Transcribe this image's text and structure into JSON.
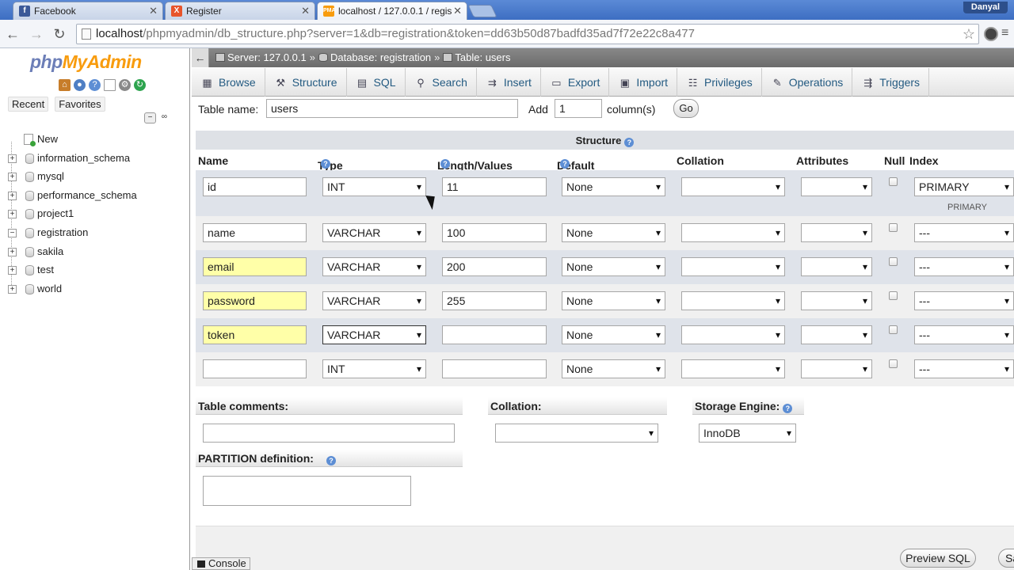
{
  "browser": {
    "tabs": [
      {
        "title": "Facebook",
        "icon": "facebook-icon",
        "color": "#3b5998"
      },
      {
        "title": "Register",
        "icon": "xampp-icon",
        "color": "#e8542b"
      },
      {
        "title": "localhost / 127.0.0.1 / regis",
        "icon": "phpmyadmin-icon",
        "color": "#f89c0e"
      }
    ],
    "user": "Danyal",
    "url_host": "localhost",
    "url_path": "/phpmyadmin/db_structure.php?server=1&db=registration&token=dd63b50d87badfd35ad7f72e22c8a477"
  },
  "sidebar": {
    "logo_php": "php",
    "logo_myadmin": "MyAdmin",
    "links": [
      "Recent",
      "Favorites"
    ],
    "tree": [
      {
        "label": "New",
        "type": "new"
      },
      {
        "label": "information_schema",
        "type": "db",
        "expander": "+"
      },
      {
        "label": "mysql",
        "type": "db",
        "expander": "+"
      },
      {
        "label": "performance_schema",
        "type": "db",
        "expander": "+"
      },
      {
        "label": "project1",
        "type": "db",
        "expander": "+"
      },
      {
        "label": "registration",
        "type": "db",
        "expander": "−"
      },
      {
        "label": "sakila",
        "type": "db",
        "expander": "+"
      },
      {
        "label": "test",
        "type": "db",
        "expander": "+"
      },
      {
        "label": "world",
        "type": "db",
        "expander": "+"
      }
    ]
  },
  "breadcrumb": {
    "server": "Server: 127.0.0.1",
    "database": "Database: registration",
    "table": "Table: users"
  },
  "menu": [
    "Browse",
    "Structure",
    "SQL",
    "Search",
    "Insert",
    "Export",
    "Import",
    "Privileges",
    "Operations",
    "Triggers"
  ],
  "table_form": {
    "table_name_label": "Table name:",
    "table_name_value": "users",
    "add_label": "Add",
    "add_value": "1",
    "columns_label": "column(s)",
    "go_label": "Go"
  },
  "structure": {
    "title": "Structure",
    "headers": [
      "Name",
      "Type",
      "Length/Values",
      "Default",
      "Collation",
      "Attributes",
      "Null",
      "Index"
    ],
    "rows": [
      {
        "name": "id",
        "type": "INT",
        "length": "11",
        "default": "None",
        "collation": "",
        "attributes": "",
        "index": "PRIMARY",
        "index_note": "PRIMARY",
        "highlight": false
      },
      {
        "name": "name",
        "type": "VARCHAR",
        "length": "100",
        "default": "None",
        "collation": "",
        "attributes": "",
        "index": "---",
        "index_note": "",
        "highlight": false
      },
      {
        "name": "email",
        "type": "VARCHAR",
        "length": "200",
        "default": "None",
        "collation": "",
        "attributes": "",
        "index": "---",
        "index_note": "",
        "highlight": true
      },
      {
        "name": "password",
        "type": "VARCHAR",
        "length": "255",
        "default": "None",
        "collation": "",
        "attributes": "",
        "index": "---",
        "index_note": "",
        "highlight": true
      },
      {
        "name": "token",
        "type": "VARCHAR",
        "length": "",
        "default": "None",
        "collation": "",
        "attributes": "",
        "index": "---",
        "index_note": "",
        "highlight": true
      },
      {
        "name": "",
        "type": "INT",
        "length": "",
        "default": "None",
        "collation": "",
        "attributes": "",
        "index": "---",
        "index_note": "",
        "highlight": false
      }
    ]
  },
  "options": {
    "table_comments_label": "Table comments:",
    "collation_label": "Collation:",
    "storage_engine_label": "Storage Engine:",
    "storage_engine_value": "InnoDB",
    "partition_label": "PARTITION definition:"
  },
  "footer": {
    "console_label": "Console",
    "preview_sql_label": "Preview SQL",
    "save_label": "Sa"
  }
}
